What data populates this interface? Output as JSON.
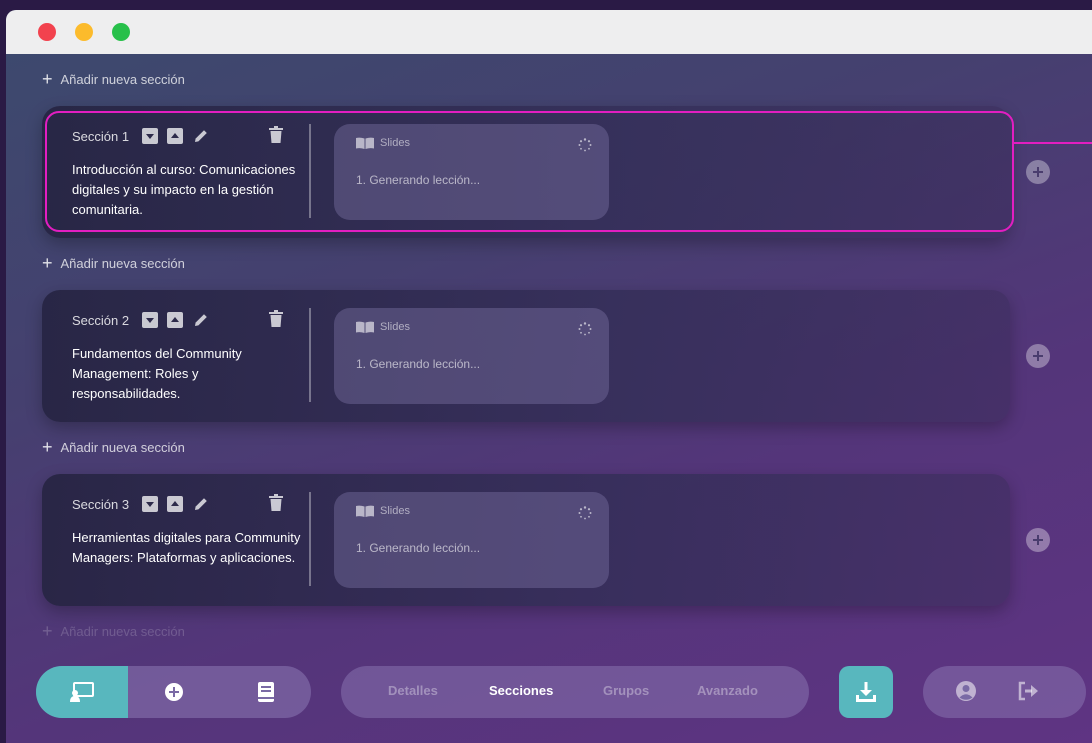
{
  "window": {
    "controls": [
      "close",
      "minimize",
      "maximize"
    ]
  },
  "add_section_label": "Añadir nueva sección",
  "sections": [
    {
      "label": "Sección 1",
      "title": "Introducción al curso: Comunicaciones digitales y su impacto en la gestión comunitaria.",
      "lesson_type": "Slides",
      "lesson_item": "1. Generando lección..."
    },
    {
      "label": "Sección 2",
      "title": "Fundamentos del Community Management: Roles y responsabilidades.",
      "lesson_type": "Slides",
      "lesson_item": "1. Generando lección..."
    },
    {
      "label": "Sección 3",
      "title": "Herramientas digitales para Community Managers: Plataformas y aplicaciones.",
      "lesson_type": "Slides",
      "lesson_item": "1. Generando lección..."
    }
  ],
  "tabs": [
    {
      "label": "Detalles",
      "active": false
    },
    {
      "label": "Secciones",
      "active": true
    },
    {
      "label": "Grupos",
      "active": false
    },
    {
      "label": "Avanzado",
      "active": false
    }
  ],
  "icons": {
    "move_down": "caret-down-icon",
    "move_up": "caret-up-icon",
    "edit": "pencil-icon",
    "delete": "trash-icon",
    "lesson": "book-open-icon",
    "loading": "spinner-icon",
    "side_add": "plus-circle-icon",
    "presentation": "presentation-icon",
    "add": "plus-circle-icon",
    "book": "book-icon",
    "download": "download-icon",
    "user": "user-circle-icon",
    "logout": "logout-icon"
  },
  "colors": {
    "accent": "#58b7be",
    "selection": "#e21ec1"
  }
}
